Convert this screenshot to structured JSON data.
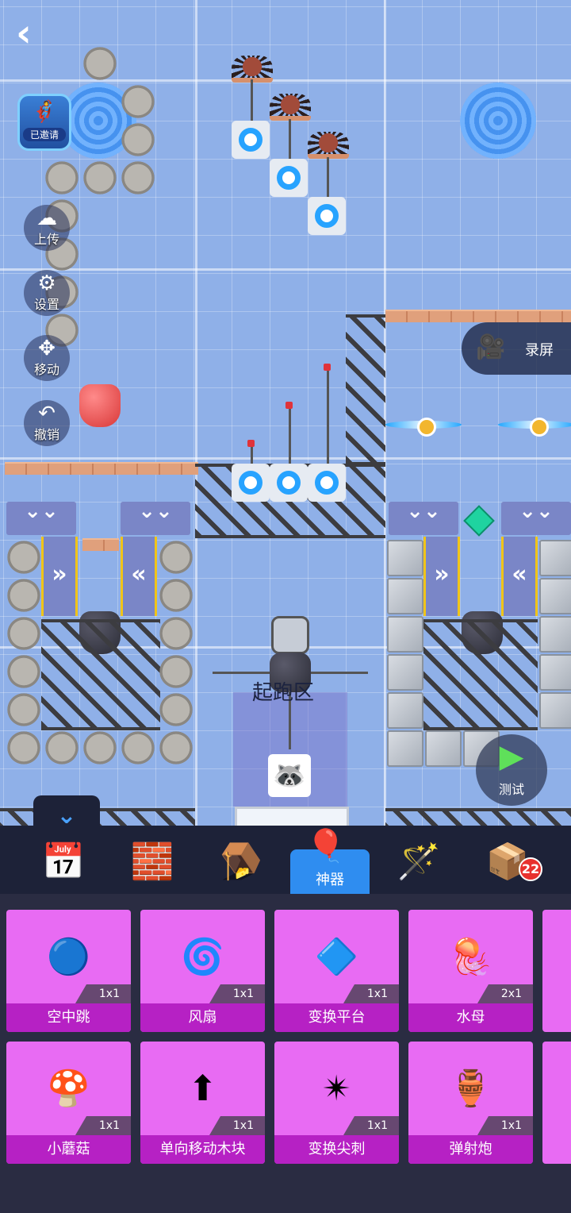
{
  "hud": {
    "back_icon": "chevron-left-icon",
    "invite_label": "已邀请",
    "upload_label": "上传",
    "settings_label": "设置",
    "move_label": "移动",
    "undo_label": "撤销",
    "record_label": "录屏",
    "test_label": "测试",
    "start_zone_label": "起跑区"
  },
  "categories": [
    {
      "name": "calendar-star",
      "icon": "📅",
      "label": ""
    },
    {
      "name": "eraser-block",
      "icon": "🧱",
      "label": ""
    },
    {
      "name": "trap-jaw",
      "icon": "🪤",
      "label": ""
    },
    {
      "name": "artifact",
      "icon": "🎈",
      "label": "神器",
      "active": true
    },
    {
      "name": "magic-wand",
      "icon": "🪄",
      "label": ""
    },
    {
      "name": "gift-box",
      "icon": "📦",
      "label": "",
      "badge": "22"
    }
  ],
  "items_row1": [
    {
      "name": "空中跳",
      "size": "1x1",
      "icon": "🔵"
    },
    {
      "name": "风扇",
      "size": "1x1",
      "icon": "🌀"
    },
    {
      "name": "变换平台",
      "size": "1x1",
      "icon": "🔷"
    },
    {
      "name": "水母",
      "size": "2x1",
      "icon": "🪼"
    }
  ],
  "items_row2": [
    {
      "name": "小蘑菇",
      "size": "1x1",
      "icon": "🍄"
    },
    {
      "name": "单向移动木块",
      "size": "1x1",
      "icon": "⬆"
    },
    {
      "name": "变换尖刺",
      "size": "1x1",
      "icon": "✴"
    },
    {
      "name": "弹射炮",
      "size": "1x1",
      "icon": "🏺"
    }
  ],
  "colors": {
    "canvas_bg": "#8fb0e8",
    "card_bg": "#e86bf3",
    "card_label_bg": "#b621c4",
    "active_tab": "#2f8df0",
    "panel_bg": "#2a2c42"
  }
}
